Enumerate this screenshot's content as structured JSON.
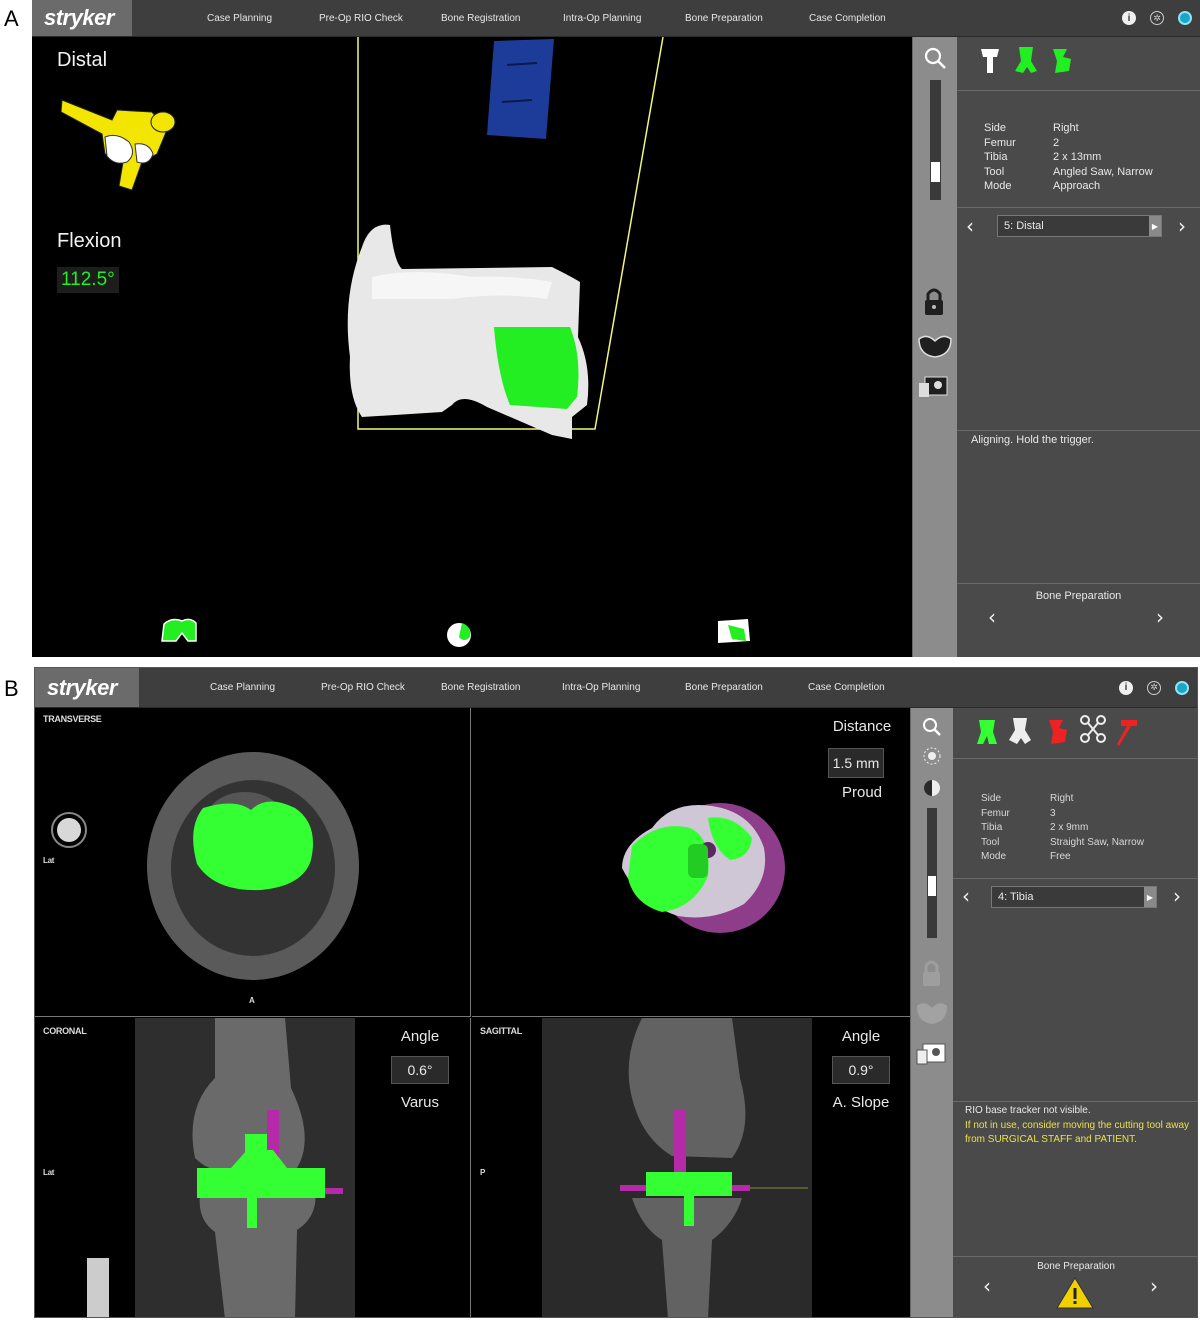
{
  "panel_letters": {
    "a": "A",
    "b": "B"
  },
  "panel_a": {
    "logo": "stryker",
    "nav": [
      "Case Planning",
      "Pre-Op RIO Check",
      "Bone Registration",
      "Intra-Op Planning",
      "Bone Preparation",
      "Case Completion"
    ],
    "viewport": {
      "cut_label": "Distal",
      "flexion_label": "Flexion",
      "flexion_value": "112.5°"
    },
    "info": [
      {
        "key": "Side",
        "value": "Right"
      },
      {
        "key": "Femur",
        "value": "2"
      },
      {
        "key": "Tibia",
        "value": "2 x 13mm"
      },
      {
        "key": "Tool",
        "value": "Angled Saw, Narrow"
      },
      {
        "key": "Mode",
        "value": "Approach"
      }
    ],
    "step_selector": "5: Distal",
    "message": "Aligning. Hold the trigger.",
    "footer_label": "Bone Preparation",
    "colors": {
      "implant_green": "#22ee22",
      "tool_yellow": "#f2e600",
      "cut_box": "#f5f57a"
    }
  },
  "panel_b": {
    "logo": "stryker",
    "nav": [
      "Case Planning",
      "Pre-Op RIO Check",
      "Bone Registration",
      "Intra-Op Planning",
      "Bone Preparation",
      "Case Completion"
    ],
    "transverse": {
      "label": "TRANSVERSE",
      "side_label": "Lat",
      "bottom_label": "A"
    },
    "view3d": {
      "title": "Distance",
      "value": "1.5 mm",
      "status": "Proud"
    },
    "coronal": {
      "label": "CORONAL",
      "side_label": "Lat",
      "title": "Angle",
      "value": "0.6°",
      "status": "Varus"
    },
    "sagittal": {
      "label": "SAGITTAL",
      "side_label": "P",
      "title": "Angle",
      "value": "0.9°",
      "status": "A. Slope"
    },
    "info": [
      {
        "key": "Side",
        "value": "Right"
      },
      {
        "key": "Femur",
        "value": "3"
      },
      {
        "key": "Tibia",
        "value": "2 x 9mm"
      },
      {
        "key": "Tool",
        "value": "Straight Saw, Narrow"
      },
      {
        "key": "Mode",
        "value": "Free"
      }
    ],
    "step_selector": "4: Tibia",
    "message_line1": "RIO base tracker not visible.",
    "message_line2": "If not in use, consider moving the cutting tool away from SURGICAL STAFF and PATIENT.",
    "footer_label": "Bone Preparation",
    "colors": {
      "implant_green": "#33ff33",
      "implant_purple": "#b42aa8",
      "warning_yellow": "#f0d000",
      "warning_text": "#e8e050"
    }
  }
}
